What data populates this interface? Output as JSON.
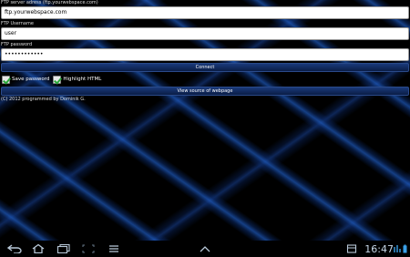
{
  "form": {
    "server_label": "FTP server adress (ftp.yourwebspace.com)",
    "server_value": "ftp.yourwebspace.com",
    "username_label": "FTP Username",
    "username_value": "user",
    "password_label": "FTP password",
    "password_value": "••••••••••••",
    "connect_label": "Connect",
    "save_password_label": "Save password",
    "highlight_html_label": "Highlight HTML",
    "view_source_label": "View source of webpage",
    "copyright": "(C) 2012 programmed by Dominik G."
  },
  "checks": {
    "save_password": true,
    "highlight_html": true
  },
  "status_bar": {
    "time": "16:47"
  },
  "icons": [
    "back-icon",
    "home-icon",
    "recent-apps-icon",
    "screenshot-icon",
    "menu-icon",
    "up-arrow-icon",
    "notification-icon",
    "wifi-icon",
    "battery-icon"
  ],
  "colors": {
    "button_bg": "#0a1c45",
    "check_green": "#2aa83a",
    "clock": "#c8d8e8"
  }
}
